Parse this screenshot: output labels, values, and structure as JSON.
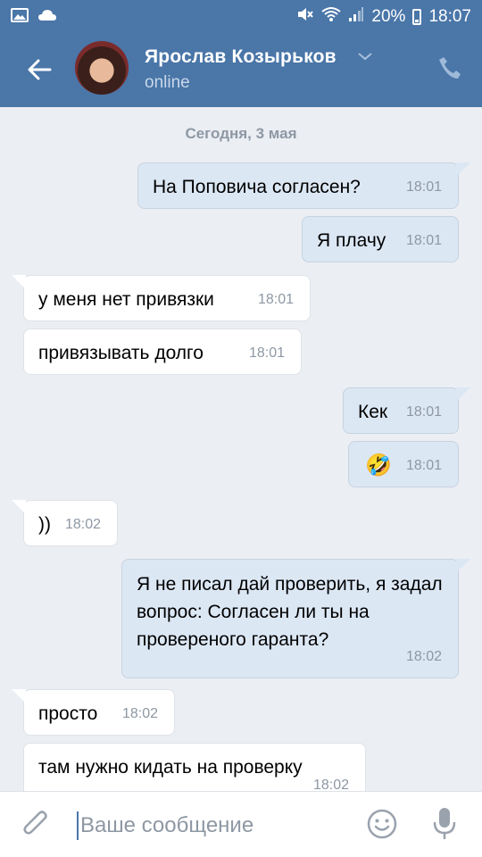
{
  "status_bar": {
    "battery": "20%",
    "time": "18:07"
  },
  "header": {
    "name": "Ярослав Козырьков",
    "status": "online"
  },
  "chat": {
    "date": "Сегодня, 3 мая",
    "messages": [
      {
        "dir": "out",
        "text": "На Поповича согласен?",
        "time": "18:01"
      },
      {
        "dir": "out",
        "text": "Я плачу",
        "time": "18:01"
      },
      {
        "dir": "in",
        "text": "у меня нет привязки",
        "time": "18:01"
      },
      {
        "dir": "in",
        "text": "привязывать долго",
        "time": "18:01"
      },
      {
        "dir": "out",
        "text": "Кек",
        "time": "18:01"
      },
      {
        "dir": "out",
        "text": "🤣",
        "time": "18:01"
      },
      {
        "dir": "in",
        "text": "))",
        "time": "18:02"
      },
      {
        "dir": "out",
        "text": "Я не писал дай проверить, я задал вопрос: Согласен ли ты на провереного гаранта?",
        "time": "18:02"
      },
      {
        "dir": "in",
        "text": "просто",
        "time": "18:02"
      },
      {
        "dir": "in",
        "text": "там нужно кидать на проверку",
        "time": "18:02"
      }
    ]
  },
  "composer": {
    "placeholder": "Ваше сообщение"
  },
  "colors": {
    "header_bg": "#4a76a8",
    "chat_bg": "#ebeef3",
    "outgoing_bubble": "#dce7f4",
    "incoming_bubble": "#ffffff"
  },
  "icons": [
    "image-icon",
    "cloud-icon",
    "mute-icon",
    "wifi-icon",
    "signal-icon",
    "battery-icon",
    "back-arrow-icon",
    "chevron-down-icon",
    "phone-icon",
    "attach-icon",
    "smile-icon",
    "mic-icon"
  ]
}
